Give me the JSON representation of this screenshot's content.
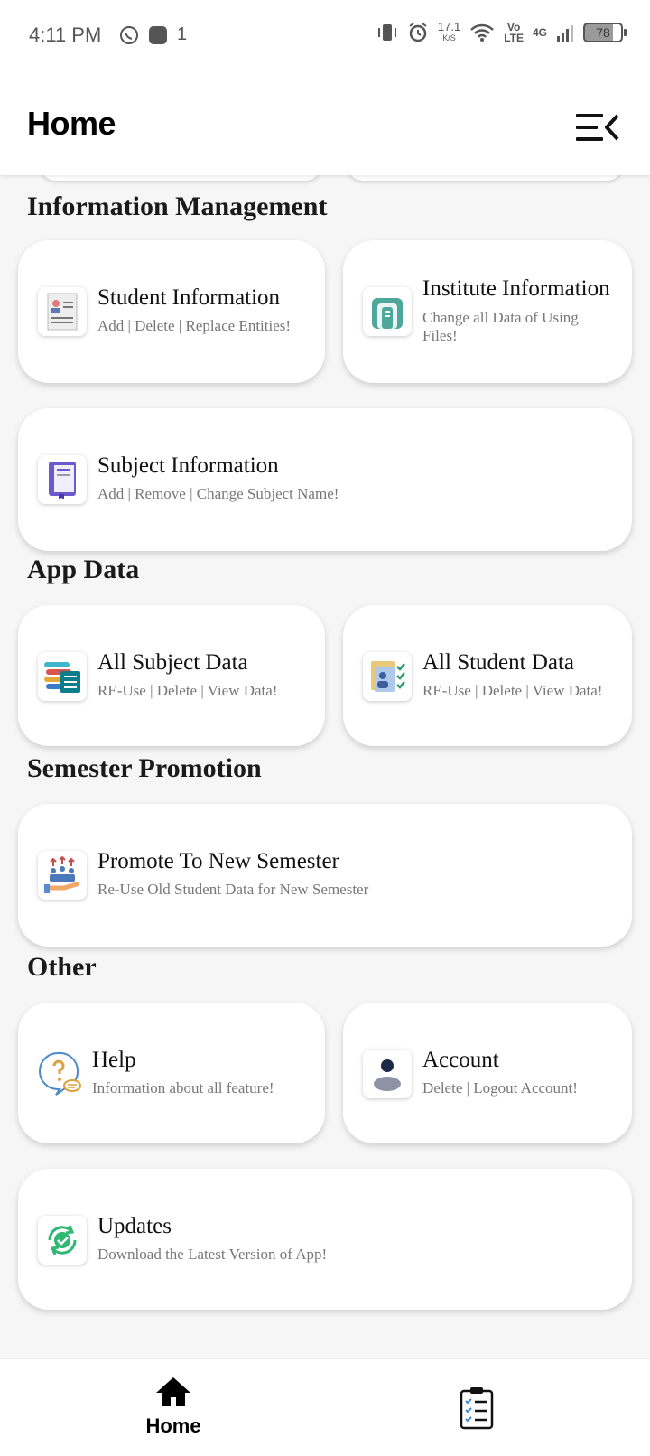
{
  "status_bar": {
    "time": "4:11 PM",
    "notif_count": "1",
    "net_speed": "17.1",
    "net_speed_unit": "K/S",
    "volte_top": "Vo",
    "volte_bottom": "LTE",
    "network": "4G",
    "battery": "78"
  },
  "header": {
    "title": "Home"
  },
  "sections": {
    "info": "Information Management",
    "app_data": "App Data",
    "semester": "Semester Promotion",
    "other": "Other"
  },
  "cards": {
    "student_info": {
      "title": "Student Information",
      "subtitle": "Add | Delete | Replace Entities!"
    },
    "institute_info": {
      "title": "Institute Information",
      "subtitle": "Change all Data of Using Files!"
    },
    "subject_info": {
      "title": "Subject Information",
      "subtitle": "Add | Remove | Change Subject Name!"
    },
    "all_subject": {
      "title": "All Subject Data",
      "subtitle": "RE-Use | Delete | View Data!"
    },
    "all_student": {
      "title": "All Student Data",
      "subtitle": "RE-Use | Delete | View Data!"
    },
    "promote": {
      "title": "Promote To New Semester",
      "subtitle": "Re-Use Old Student Data for New Semester"
    },
    "help": {
      "title": "Help",
      "subtitle": "Information about all feature!"
    },
    "account": {
      "title": "Account",
      "subtitle": "Delete | Logout Account!"
    },
    "updates": {
      "title": "Updates",
      "subtitle": "Download the Latest Version of App!"
    }
  },
  "bottom_nav": {
    "home_label": "Home"
  },
  "colors": {
    "background": "#f6f6f6",
    "card": "#ffffff",
    "accent_green": "#2eb872"
  }
}
